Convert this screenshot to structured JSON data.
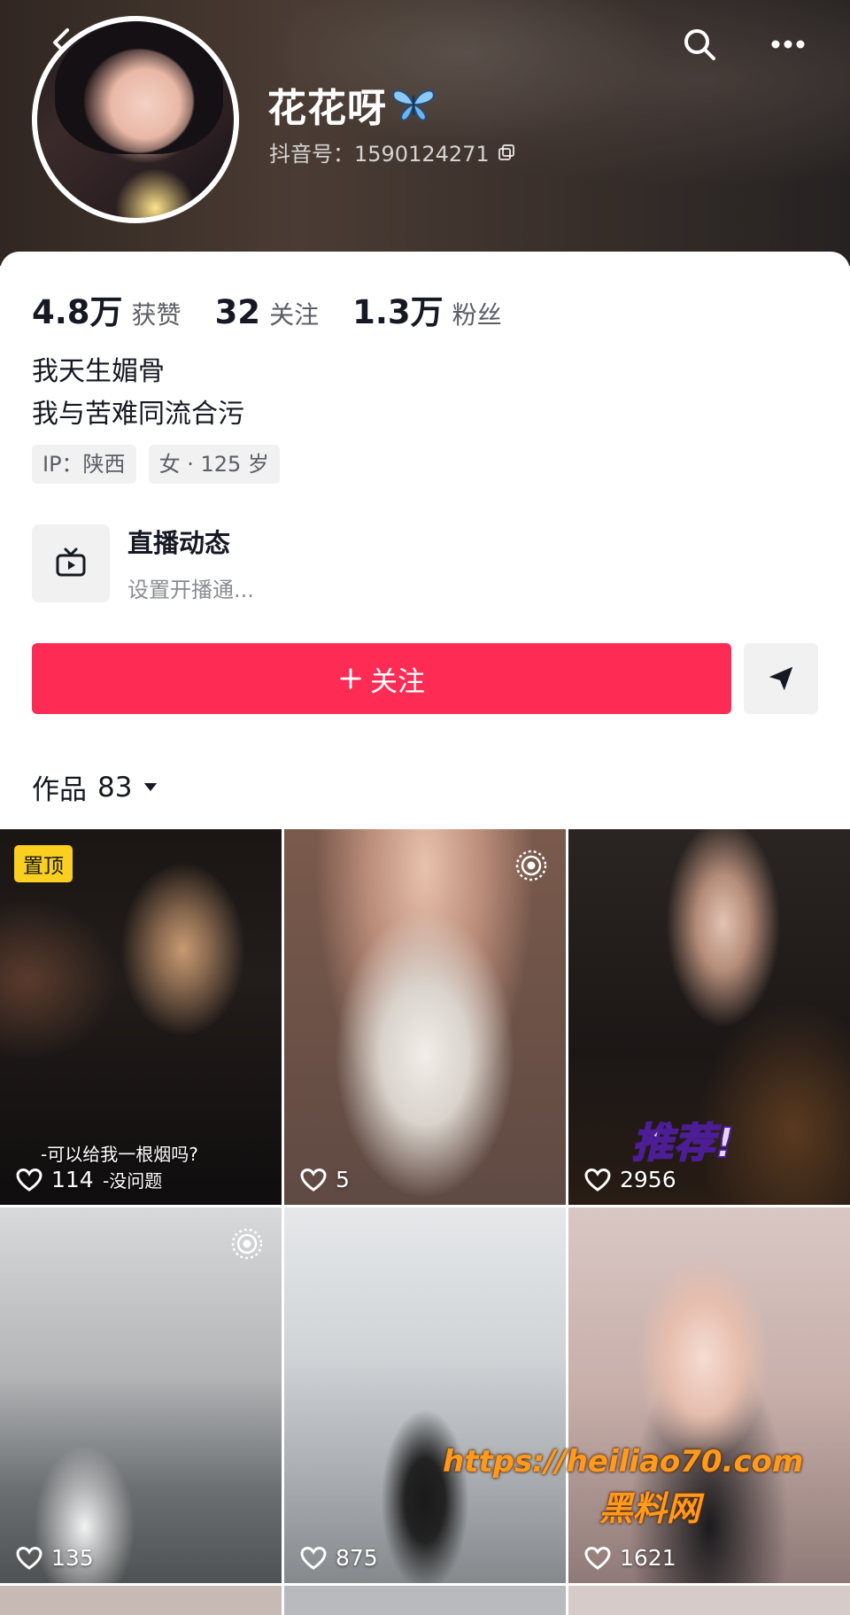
{
  "header": {
    "username": "花花呀",
    "douyin_id": "抖音号：1590124271"
  },
  "stats": [
    {
      "value": "4.8万",
      "label": "获赞"
    },
    {
      "value": "32",
      "label": "关注"
    },
    {
      "value": "1.3万",
      "label": "粉丝"
    }
  ],
  "bio": [
    "我天生媚骨",
    "我与苦难同流合污"
  ],
  "tags": [
    "IP：陕西",
    "女 · 125 岁"
  ],
  "live": {
    "title": "直播动态",
    "subtitle": "设置开播通..."
  },
  "actions": {
    "follow_label": "关注"
  },
  "works": {
    "label": "作品",
    "count": "83"
  },
  "videos": [
    {
      "likes": "114",
      "pinned_label": "置顶",
      "caption_top": "-可以给我一根烟吗?",
      "caption_bottom": "-没问题"
    },
    {
      "likes": "5"
    },
    {
      "likes": "2956",
      "sticker": "推荐!"
    },
    {
      "likes": "135"
    },
    {
      "likes": "875"
    },
    {
      "likes": "1621"
    }
  ],
  "watermark": {
    "url": "https://heiliao70.com",
    "text": "黑料网"
  },
  "colors": {
    "accent": "#fe2c55",
    "pin_badge": "#facf1f"
  }
}
